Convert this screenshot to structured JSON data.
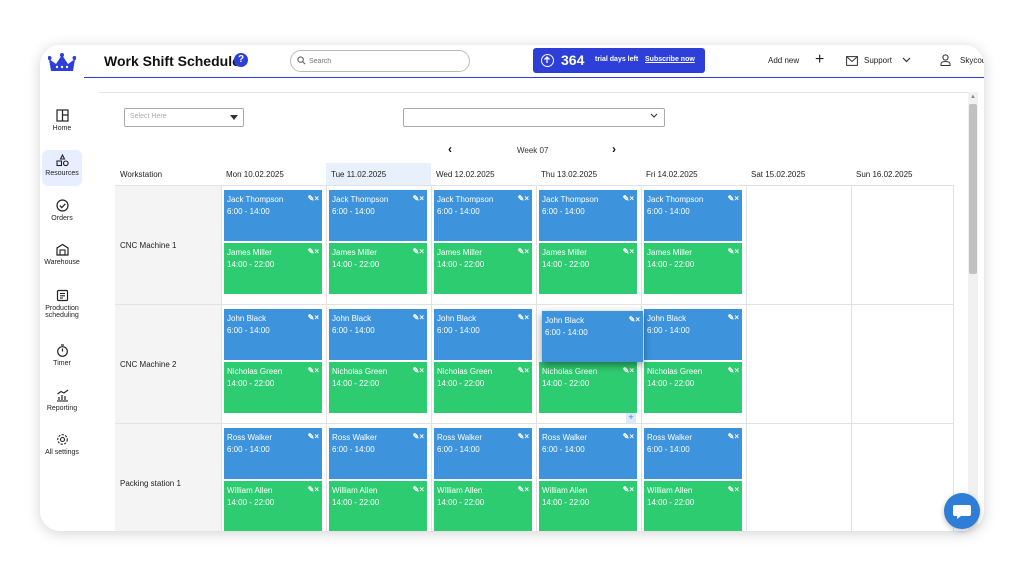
{
  "app": {
    "title": "Work Shift Scheduler",
    "help": "?"
  },
  "header": {
    "search_placeholder": "Search",
    "trial_days": "364",
    "trial_label": "trial days left",
    "subscribe": "Subscribe now",
    "add_new": "Add new",
    "support": "Support",
    "user": "Skycode"
  },
  "sidebar": {
    "items": [
      {
        "label": "Home",
        "icon": "home-icon"
      },
      {
        "label": "Resources",
        "icon": "resources-icon"
      },
      {
        "label": "Orders",
        "icon": "orders-icon"
      },
      {
        "label": "Warehouse",
        "icon": "warehouse-icon"
      },
      {
        "label": "Production scheduling",
        "icon": "production-icon"
      },
      {
        "label": "Timer",
        "icon": "timer-icon"
      },
      {
        "label": "Reporting",
        "icon": "reporting-icon"
      },
      {
        "label": "All settings",
        "icon": "settings-icon"
      }
    ]
  },
  "filters": {
    "select1_placeholder": "Select Here",
    "select2_value": ""
  },
  "week": {
    "label": "Week 07"
  },
  "columns": [
    "Workstation",
    "Mon 10.02.2025",
    "Tue 11.02.2025",
    "Wed 12.02.2025",
    "Thu 13.02.2025",
    "Fri 14.02.2025",
    "Sat 15.02.2025",
    "Sun 16.02.2025"
  ],
  "today_index": 2,
  "rows": [
    {
      "label": "CNC Machine 1",
      "top_name": "Jack Thompson",
      "top_time": "6:00 - 14:00",
      "bottom_name": "James Miller",
      "bottom_time": "14:00 - 22:00"
    },
    {
      "label": "CNC Machine 2",
      "top_name": "John Black",
      "top_time": "6:00 - 14:00",
      "bottom_name": "Nicholas Green",
      "bottom_time": "14:00 - 22:00"
    },
    {
      "label": "Packing station 1",
      "top_name": "Ross Walker",
      "top_time": "6:00 - 14:00",
      "bottom_name": "William Allen",
      "bottom_time": "14:00 - 22:00"
    }
  ],
  "colors": {
    "accent": "#2d3fd8",
    "shift_morning": "#3d93dc",
    "shift_afternoon": "#2ecc71",
    "today_bg": "#e8f1fb"
  }
}
